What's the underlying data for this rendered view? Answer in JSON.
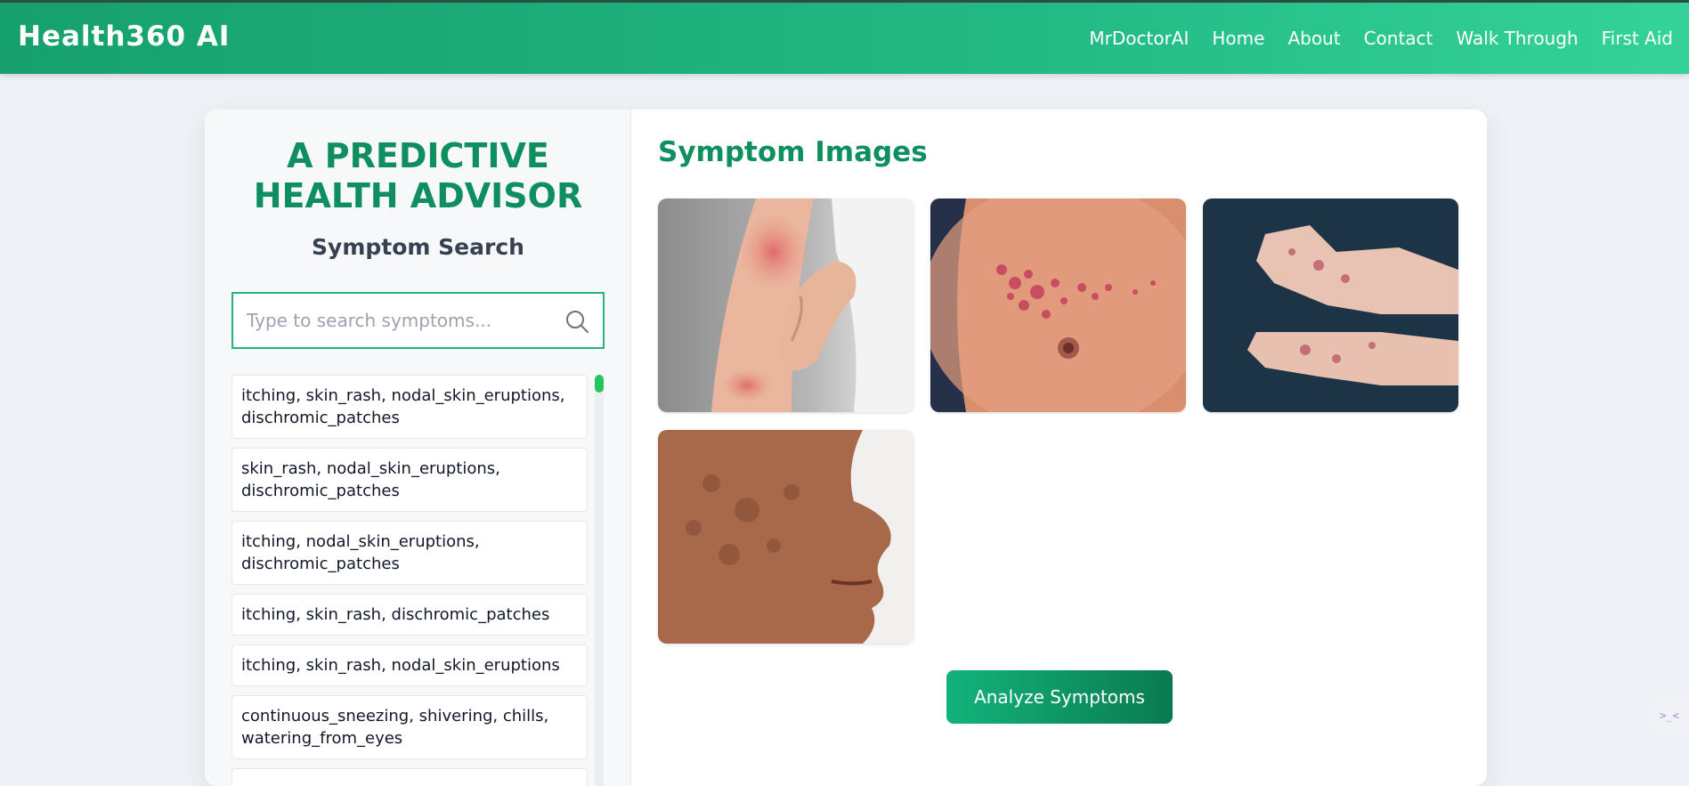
{
  "header": {
    "brand": "Health360 AI",
    "nav": [
      "MrDoctorAI",
      "Home",
      "About",
      "Contact",
      "Walk Through",
      "First Aid"
    ]
  },
  "left": {
    "title_line1": "A PREDICTIVE",
    "title_line2": "HEALTH ADVISOR",
    "subtitle": "Symptom Search",
    "search_placeholder": "Type to search symptoms...",
    "results": [
      "itching, skin_rash, nodal_skin_eruptions, dischromic_patches",
      "skin_rash, nodal_skin_eruptions, dischromic_patches",
      "itching, nodal_skin_eruptions, dischromic_patches",
      "itching, skin_rash, dischromic_patches",
      "itching, skin_rash, nodal_skin_eruptions",
      "continuous_sneezing, shivering, chills, watering_from_eyes"
    ]
  },
  "right": {
    "title": "Symptom Images",
    "analyze_button": "Analyze Symptoms"
  },
  "colors": {
    "brand_green": "#16a06d",
    "title_green": "#0f8f5f",
    "search_border": "#22b573"
  },
  "widget": {
    "glyph": ">_<"
  }
}
